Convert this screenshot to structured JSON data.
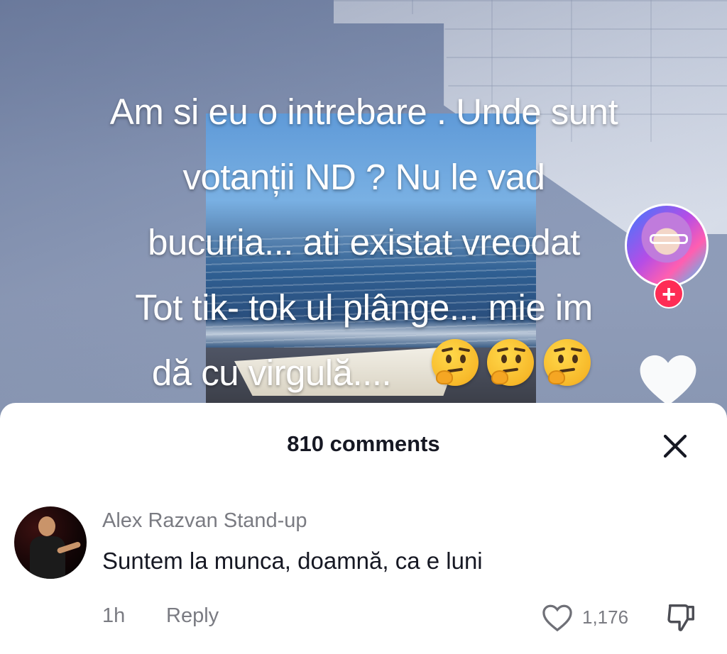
{
  "video": {
    "caption_lines": [
      "Am si eu o intrebare . Unde sunt",
      "votanții ND ? Nu le vad",
      "bucuria...   ati existat vreodat",
      "Tot tik- tok ul plânge... mie im",
      "dă cu virgulă...."
    ],
    "follow_label": "+"
  },
  "comments_sheet": {
    "title": "810 comments"
  },
  "comment": {
    "username": "Alex Razvan Stand-up",
    "text": "Suntem la munca, doamnă, ca e luni",
    "time": "1h",
    "reply_label": "Reply",
    "like_count": "1,176"
  },
  "colors": {
    "accent": "#fe2c55",
    "secondary_text": "#7a7b82",
    "primary_text": "#161823"
  }
}
